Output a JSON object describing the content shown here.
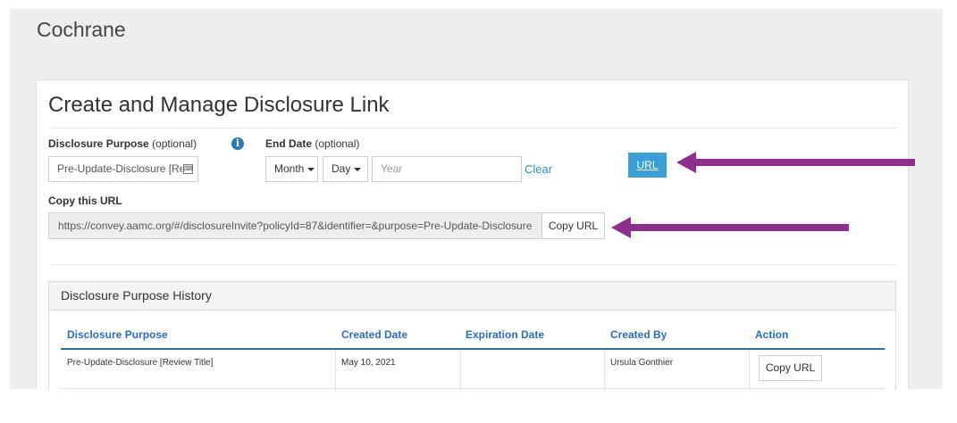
{
  "app": {
    "title": "Cochrane"
  },
  "panel": {
    "title": "Create and Manage Disclosure Link"
  },
  "form": {
    "purpose_label": "Disclosure Purpose",
    "purpose_optional": "(optional)",
    "purpose_value": "Pre-Update-Disclosure [Re",
    "end_date_label": "End Date",
    "end_date_optional": "(optional)",
    "month_label": "Month",
    "day_label": "Day",
    "year_placeholder": "Year",
    "clear_label": "Clear",
    "url_button": "URL",
    "copy_url_label": "Copy this URL",
    "url_value": "https://convey.aamc.org/#/disclosureInvite?policyId=87&identifier=&purpose=Pre-Update-Disclosure",
    "copy_url_button": "Copy URL"
  },
  "history": {
    "title": "Disclosure Purpose History",
    "columns": [
      "Disclosure Purpose",
      "Created Date",
      "Expiration Date",
      "Created By",
      "Action"
    ],
    "rows": [
      {
        "purpose": "Pre-Update-Disclosure [Review Title]",
        "created_date": "May 10, 2021",
        "expiration_date": "",
        "created_by": "Ursula Gonthier",
        "action": "Copy URL"
      }
    ]
  },
  "colors": {
    "accent": "#3b9fd8",
    "arrow": "#8e2f8e",
    "header_text": "#2a6ebb"
  }
}
